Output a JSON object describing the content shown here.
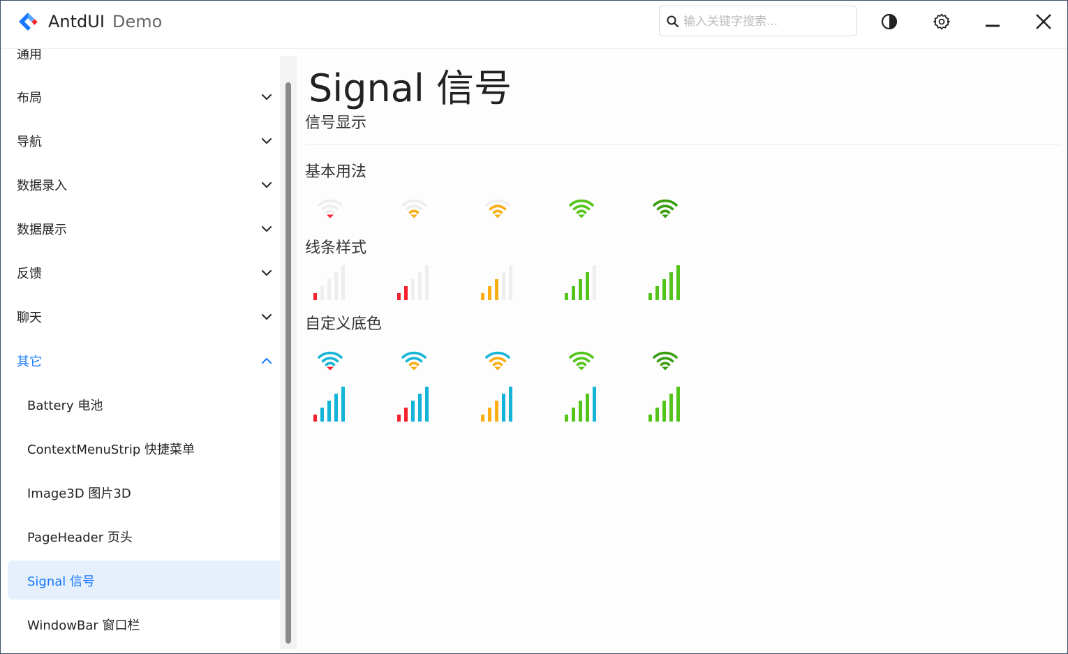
{
  "app": {
    "name": "AntdUI",
    "subtitle": "Demo"
  },
  "search": {
    "placeholder": "输入关键字搜索..."
  },
  "titlebar": {
    "theme_icon": "contrast-icon",
    "settings_icon": "gear-icon",
    "minimize_icon": "minimize-icon",
    "close_icon": "close-icon"
  },
  "sidebar": {
    "partial_label": "通用",
    "groups": [
      {
        "label": "布局"
      },
      {
        "label": "导航"
      },
      {
        "label": "数据录入"
      },
      {
        "label": "数据展示"
      },
      {
        "label": "反馈"
      },
      {
        "label": "聊天"
      },
      {
        "label": "其它"
      }
    ],
    "sub_items": [
      {
        "label": "Battery 电池"
      },
      {
        "label": "ContextMenuStrip 快捷菜单"
      },
      {
        "label": "Image3D 图片3D"
      },
      {
        "label": "PageHeader 页头"
      },
      {
        "label": "Signal 信号"
      },
      {
        "label": "WindowBar 窗口栏"
      }
    ]
  },
  "main": {
    "title": "Signal 信号",
    "description": "信号显示",
    "sections": [
      {
        "title": "基本用法"
      },
      {
        "title": "线条样式"
      },
      {
        "title": "自定义底色"
      }
    ]
  },
  "signals": {
    "levels": [
      1,
      2,
      3,
      4,
      5
    ],
    "level_colors": [
      "#f5222d",
      "#faad14",
      "#faad14",
      "#52c41a",
      "#389e0d"
    ],
    "line_colors": [
      "#f5222d",
      "#f5222d",
      "#faad14",
      "#52c41a",
      "#52c41a"
    ],
    "empty_color": "#eeeeee",
    "custom_fill_color": "#13b4d6"
  },
  "colors": {
    "primary": "#1677ff",
    "selected_bg": "#e6f0fd"
  }
}
